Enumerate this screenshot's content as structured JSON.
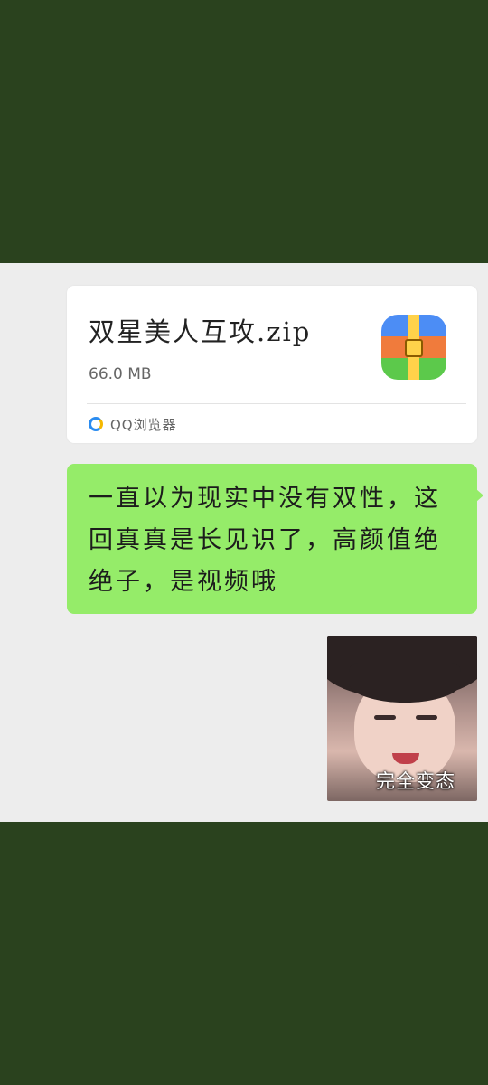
{
  "file_message": {
    "file_name": "双星美人互攻.zip",
    "file_size": "66.0 MB",
    "file_icon": "zip-archive-icon",
    "source_label": "QQ浏览器",
    "source_icon": "qq-browser-icon"
  },
  "text_message": {
    "text": "一直以为现实中没有双性，这回真真是长见识了，高颜值绝绝子，是视频哦",
    "bubble_color": "#95ec69"
  },
  "sticker_message": {
    "caption": "完全变态"
  },
  "colors": {
    "background": "#2a421e",
    "chat_background": "#ededed"
  }
}
